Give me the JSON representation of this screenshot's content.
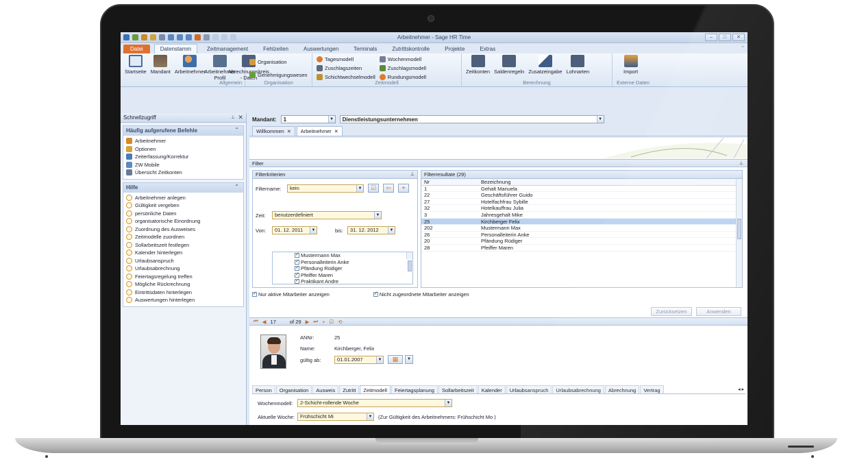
{
  "window": {
    "title": "Arbeitnehmer - Sage HR Time"
  },
  "ribbon_tabs": [
    "Datei",
    "Datenstamm",
    "Zeitmanagement",
    "Fehlzeiten",
    "Auswertungen",
    "Terminals",
    "Zutrittskontrolle",
    "Projekte",
    "Extras"
  ],
  "ribbon": {
    "allgemein": {
      "label": "Allgemein",
      "buttons": [
        "Startseite",
        "Mandant",
        "Arbeitnehmer",
        "Arbeitnehmer Profil",
        "Abrechnungskreis - Daten"
      ]
    },
    "organisation": {
      "label": "Organisation",
      "buttons": [
        "Organisation",
        "Genehmigungswesen"
      ]
    },
    "zeitmodell": {
      "label": "Zeitmodell",
      "col1": [
        "Tagesmodell",
        "Zuschlagszeiten",
        "Schichtwechselmodell"
      ],
      "col2": [
        "Wochenmodell",
        "Zuschlagsmodell",
        "Rundungsmodell"
      ]
    },
    "berechnung": {
      "label": "Berechnung",
      "buttons": [
        "Zeitkonten",
        "Saldenregeln",
        "Zusatzeingabe",
        "Lohnarten"
      ]
    },
    "externe": {
      "label": "Externe Daten",
      "buttons": [
        "Import"
      ]
    }
  },
  "schnellzugriff": {
    "title": "Schnellzugriff",
    "section1": {
      "title": "Häufig aufgerufene Befehle",
      "items": [
        "Arbeitnehmer",
        "Optionen",
        "Zeiterfassung/Korrektur",
        "ZW Mobile",
        "Übersicht Zeitkonten"
      ]
    },
    "section2": {
      "title": "Hilfe",
      "items": [
        "Arbeitnehmer anlegen",
        "Gültigkeit vergeben",
        "persönliche Daten",
        "organisatorische Einordnung",
        "Zuordnung des Ausweises",
        "Zeitmodelle zuordnen",
        "Sollarbeitszeit festlegen",
        "Kalender hinterlegen",
        "Urlaubsanspruch",
        "Urlaubsabrechnung",
        "Feiertagsregelung treffen",
        "Mögliche Rückrechnung",
        "Eintrittsdaten hinterlegen",
        "Auswertungen hinterlegen"
      ]
    }
  },
  "mandant": {
    "label": "Mandant:",
    "number": "1",
    "name": "Dienstleistungsunternehmen"
  },
  "doc_tabs": [
    "Willkommen",
    "Arbeitnehmer"
  ],
  "filter": {
    "title": "Filter",
    "criteria_title": "Filterkriterien",
    "filtername_label": "Filtername:",
    "filtername_value": "kein",
    "zeit_label": "Zeit:",
    "zeit_value": "benutzerdefiniert",
    "von_label": "Von:",
    "von_value": "01. 12. 2011",
    "bis_label": "bis:",
    "bis_value": "31. 12. 2012",
    "names": [
      "Mustermann Max",
      "Personalleiterin Anke",
      "Pfändung Rüdiger",
      "Pfeiffer Maren",
      "Praktikant Andre"
    ],
    "opt1": "Nur aktive Mitarbeiter anzeigen",
    "opt2": "Nicht zugeordnete Mitarbeiter anzeigen",
    "reset": "Zurücksetzen",
    "apply": "Anwenden"
  },
  "results": {
    "title": "Filterresultate (29)",
    "col_nr": "Nr",
    "col_bez": "Bezeichnung",
    "rows": [
      {
        "nr": "1",
        "bez": "Gehalt Manuela"
      },
      {
        "nr": "22",
        "bez": "Geschäftsführer Guido"
      },
      {
        "nr": "27",
        "bez": "Hotelfachfrau Sybille"
      },
      {
        "nr": "32",
        "bez": "Hotelkauffrau Julia"
      },
      {
        "nr": "3",
        "bez": "Jahresgehalt Mike"
      },
      {
        "nr": "25",
        "bez": "Kirchberger Felix"
      },
      {
        "nr": "202",
        "bez": "Mustermann Max"
      },
      {
        "nr": "26",
        "bez": "Personalleiterin Anke"
      },
      {
        "nr": "20",
        "bez": "Pfändung Rüdiger"
      },
      {
        "nr": "28",
        "bez": "Pfeiffer Maren"
      }
    ],
    "selected_index": 5
  },
  "navigator": {
    "position": "17",
    "total": "of 29"
  },
  "employee": {
    "anr_label": "ANNr:",
    "anr": "25",
    "name_label": "Name:",
    "name": "Kirchberger, Felix",
    "valid_label": "gültig ab:",
    "valid": "01.01.2007"
  },
  "detail_tabs": [
    "Person",
    "Organisation",
    "Ausweis",
    "Zutritt",
    "Zeitmodell",
    "Feiertagsplanung",
    "Sollarbeitszeit",
    "Kalender",
    "Urlaubsanspruch",
    "Urlaubsabrechnung",
    "Abrechnung",
    "Vertrag"
  ],
  "active_detail_tab": "Zeitmodell",
  "zeitmodell": {
    "wochenmodell_label": "Wochenmodell:",
    "wochenmodell_value": "2-Schicht-rollende Woche",
    "woche_label": "Aktuelle Woche:",
    "woche_value": "Frühschicht Mi",
    "woche_note": "(Zur Gültigkeit des Arbeitnehmers: Frühschicht Mo )"
  }
}
